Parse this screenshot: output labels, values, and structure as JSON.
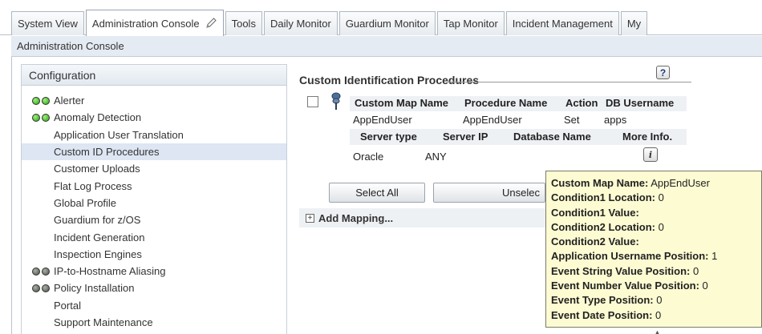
{
  "tabs": [
    {
      "label": "System View",
      "active": false
    },
    {
      "label": "Administration Console",
      "active": true,
      "icon": "pencil-icon"
    },
    {
      "label": "Tools",
      "active": false
    },
    {
      "label": "Daily Monitor",
      "active": false
    },
    {
      "label": "Guardium Monitor",
      "active": false
    },
    {
      "label": "Tap Monitor",
      "active": false
    },
    {
      "label": "Incident Management",
      "active": false
    },
    {
      "label": "My",
      "active": false
    }
  ],
  "subheader": "Administration Console",
  "config": {
    "title": "Configuration",
    "items": [
      {
        "label": "Alerter",
        "status": "green-green"
      },
      {
        "label": "Anomaly Detection",
        "status": "green-green"
      },
      {
        "label": "Application User Translation",
        "status": "none"
      },
      {
        "label": "Custom ID Procedures",
        "status": "none",
        "selected": true
      },
      {
        "label": "Customer Uploads",
        "status": "none"
      },
      {
        "label": "Flat Log Process",
        "status": "none"
      },
      {
        "label": "Global Profile",
        "status": "none"
      },
      {
        "label": "Guardium for z/OS",
        "status": "none"
      },
      {
        "label": "Incident Generation",
        "status": "none"
      },
      {
        "label": "Inspection Engines",
        "status": "none"
      },
      {
        "label": "IP-to-Hostname Aliasing",
        "status": "dark-dark"
      },
      {
        "label": "Policy Installation",
        "status": "dark-dark"
      },
      {
        "label": "Portal",
        "status": "none"
      },
      {
        "label": "Support Maintenance",
        "status": "none"
      }
    ]
  },
  "main": {
    "title": "Custom Identification Procedures",
    "help_label": "?",
    "table1": {
      "headers": [
        "Custom Map Name",
        "Procedure Name",
        "Action",
        "DB Username"
      ],
      "row": [
        "AppEndUser",
        "AppEndUser",
        "Set",
        "apps"
      ]
    },
    "table2": {
      "headers": [
        "Server type",
        "Server IP",
        "Database Name",
        "More Info."
      ],
      "row": [
        "Oracle",
        "ANY",
        ""
      ]
    },
    "info_label": "i",
    "select_all": "Select All",
    "unselect_all": "Unselec",
    "add_mapping": "Add Mapping...",
    "plus_label": "+"
  },
  "tooltip": {
    "lines": [
      {
        "key": "Custom Map Name:",
        "value": " AppEndUser"
      },
      {
        "key": "Condition1 Location:",
        "value": " 0"
      },
      {
        "key": "Condition1 Value:",
        "value": ""
      },
      {
        "key": "Condition2 Location:",
        "value": " 0"
      },
      {
        "key": "Condition2 Value:",
        "value": ""
      },
      {
        "key": "Application Username Position:",
        "value": " 1"
      },
      {
        "key": "Event String Value Position:",
        "value": " 0"
      },
      {
        "key": "Event Number Value Position:",
        "value": " 0"
      },
      {
        "key": "Event Type Position:",
        "value": " 0"
      },
      {
        "key": "Event Date Position:",
        "value": " 0"
      }
    ]
  },
  "colors": {
    "status_green": "#23a30f",
    "status_dark": "#4a5146",
    "tooltip_bg": "#fdfbd2",
    "selected_bg": "#dde6f2"
  }
}
